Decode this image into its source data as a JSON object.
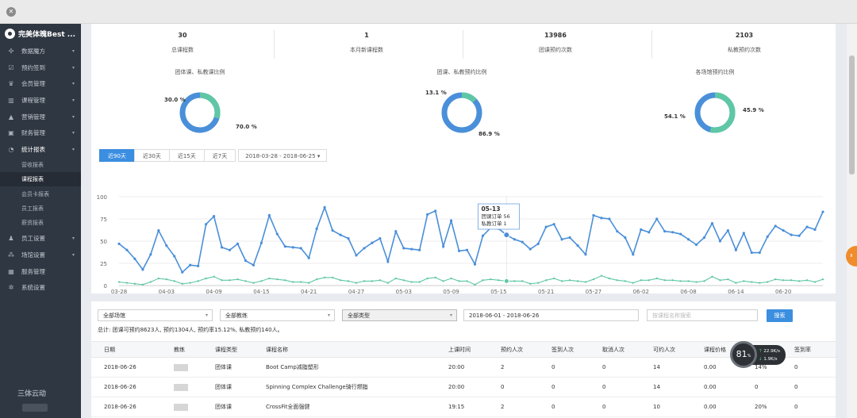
{
  "sidebar": {
    "brand": "完美体魄Best ...",
    "items": [
      {
        "label": "数据魔方",
        "icon": "puzzle-icon"
      },
      {
        "label": "预约签到",
        "icon": "checkbox-icon"
      },
      {
        "label": "会员管理",
        "icon": "crown-icon"
      },
      {
        "label": "课程管理",
        "icon": "book-icon"
      },
      {
        "label": "营销管理",
        "icon": "chart-icon"
      },
      {
        "label": "财务管理",
        "icon": "wallet-icon"
      },
      {
        "label": "统计报表",
        "icon": "pie-icon"
      }
    ],
    "subitems": [
      "营收报表",
      "课程报表",
      "会员卡报表",
      "员工报表",
      "薪资报表"
    ],
    "active_subitem": "课程报表",
    "items_after": [
      {
        "label": "员工设置",
        "icon": "person-icon"
      },
      {
        "label": "场馆设置",
        "icon": "sitemap-icon"
      },
      {
        "label": "服务管理",
        "icon": "grid-icon"
      },
      {
        "label": "系统设置",
        "icon": "gear-icon"
      }
    ],
    "footer_logo": "三体云动"
  },
  "stats": [
    {
      "value": "30",
      "label": "总课程数"
    },
    {
      "value": "1",
      "label": "本月新课程数"
    },
    {
      "value": "13986",
      "label": "团课预约次数"
    },
    {
      "value": "2103",
      "label": "私教预约次数"
    }
  ],
  "donuts": [
    {
      "title": "团体课、私教课比例",
      "a_label": "30.0 %",
      "b_label": "70.0 %",
      "a": 30.0,
      "b": 70.0
    },
    {
      "title": "团课、私教预约比例",
      "a_label": "13.1 %",
      "b_label": "86.9 %",
      "a": 13.1,
      "b": 86.9
    },
    {
      "title": "各场馆预约比例",
      "a_label": "54.1 %",
      "b_label": "45.9 %",
      "a": 54.1,
      "b": 45.9
    }
  ],
  "colors": {
    "blue": "#4a8fd9",
    "teal": "#5fc7a5",
    "accent": "#3b8ee0",
    "sidebar": "#2f3742"
  },
  "range_tabs": [
    "近90天",
    "近30天",
    "近15天",
    "近7天"
  ],
  "active_tab": "近90天",
  "date_range": "2018-03-28 - 2018-06-25",
  "chart_data": {
    "type": "line",
    "x": [
      "03-28",
      "03-29",
      "03-30",
      "03-31",
      "04-01",
      "04-02",
      "04-03",
      "04-04",
      "04-05",
      "04-06",
      "04-07",
      "04-08",
      "04-09",
      "04-10",
      "04-11",
      "04-12",
      "04-13",
      "04-14",
      "04-15",
      "04-16",
      "04-17",
      "04-18",
      "04-19",
      "04-20",
      "04-21",
      "04-22",
      "04-23",
      "04-24",
      "04-25",
      "04-26",
      "04-27",
      "04-28",
      "04-29",
      "04-30",
      "05-01",
      "05-02",
      "05-03",
      "05-04",
      "05-05",
      "05-06",
      "05-07",
      "05-08",
      "05-09",
      "05-10",
      "05-11",
      "05-12",
      "05-13",
      "05-14",
      "05-15",
      "05-16",
      "05-17",
      "05-18",
      "05-19",
      "05-20",
      "05-21",
      "05-22",
      "05-23",
      "05-24",
      "05-25",
      "05-26",
      "05-27",
      "05-28",
      "05-29",
      "05-30",
      "05-31",
      "06-01",
      "06-02",
      "06-03",
      "06-04",
      "06-05",
      "06-06",
      "06-07",
      "06-08",
      "06-09",
      "06-10",
      "06-11",
      "06-12",
      "06-13",
      "06-14",
      "06-15",
      "06-16",
      "06-17",
      "06-18",
      "06-19",
      "06-20",
      "06-21",
      "06-22",
      "06-23",
      "06-24",
      "06-25"
    ],
    "xticks": [
      "03-28",
      "04-03",
      "04-09",
      "04-15",
      "04-21",
      "04-27",
      "05-03",
      "05-09",
      "05-15",
      "05-21",
      "05-27",
      "06-02",
      "06-08",
      "06-14",
      "06-20"
    ],
    "ylim": [
      0,
      100
    ],
    "yticks": [
      0,
      25,
      50,
      75,
      100
    ],
    "series": [
      {
        "name": "团课订单",
        "color": "#4a8fd9",
        "values": [
          47,
          40,
          30,
          18,
          35,
          62,
          45,
          33,
          15,
          23,
          22,
          69,
          78,
          43,
          40,
          47,
          28,
          23,
          48,
          79,
          58,
          44,
          43,
          42,
          31,
          64,
          88,
          62,
          57,
          53,
          34,
          42,
          48,
          53,
          27,
          61,
          42,
          41,
          40,
          80,
          84,
          44,
          73,
          39,
          40,
          24,
          56,
          65,
          64,
          57,
          52,
          49,
          41,
          47,
          66,
          69,
          52,
          54,
          45,
          35,
          79,
          76,
          75,
          61,
          54,
          35,
          63,
          60,
          75,
          61,
          60,
          58,
          52,
          46,
          54,
          70,
          50,
          62,
          40,
          59,
          37,
          37,
          55,
          67,
          62,
          57,
          56,
          66,
          63,
          83
        ]
      },
      {
        "name": "私教订单",
        "color": "#5fc7a5",
        "values": [
          4,
          3,
          2,
          1,
          4,
          8,
          7,
          5,
          2,
          3,
          5,
          8,
          10,
          6,
          6,
          7,
          5,
          3,
          5,
          8,
          7,
          6,
          4,
          4,
          3,
          7,
          9,
          9,
          6,
          5,
          3,
          5,
          5,
          6,
          3,
          8,
          6,
          4,
          4,
          8,
          9,
          5,
          8,
          5,
          5,
          1,
          6,
          7,
          6,
          5,
          5,
          5,
          2,
          3,
          6,
          8,
          5,
          6,
          5,
          4,
          7,
          11,
          8,
          6,
          5,
          3,
          6,
          6,
          8,
          6,
          6,
          5,
          5,
          4,
          5,
          10,
          6,
          7,
          3,
          5,
          4,
          3,
          4,
          7,
          6,
          6,
          5,
          6,
          4,
          7
        ]
      }
    ],
    "tooltip": {
      "date": "05-13",
      "line1": "团课订单  56",
      "line2": "私教订单  1"
    }
  },
  "filters": {
    "venue": "全部场馆",
    "coach": "全部教练",
    "type": "全部类型",
    "date": "2018-06-01 - 2018-06-26",
    "search_placeholder": "按课程名称搜索",
    "search_button": "搜索"
  },
  "summary": "总计: 团课可预约8623人, 预约1304人, 预约率15.12%, 私教预约140人。",
  "table": {
    "columns": [
      "日期",
      "教练",
      "课程类型",
      "课程名称",
      "上课时间",
      "预约人次",
      "签到人次",
      "取消人次",
      "可约人次",
      "课程价格",
      "",
      "签到率"
    ],
    "rows": [
      [
        "2018-06-26",
        "",
        "团体课",
        "Boot Camp减脂塑形",
        "20:00",
        "2",
        "0",
        "0",
        "14",
        "0.00",
        "14%",
        "0"
      ],
      [
        "2018-06-26",
        "",
        "团体课",
        "Spinning Complex Challenge骑行燃脂",
        "20:00",
        "0",
        "0",
        "0",
        "14",
        "0.00",
        "0",
        "0"
      ],
      [
        "2018-06-26",
        "",
        "团体课",
        "CrossFit全面强健",
        "19:15",
        "2",
        "0",
        "0",
        "10",
        "0.00",
        "20%",
        "0"
      ]
    ]
  },
  "speed": {
    "percent": "81",
    "unit": "%",
    "up": "22.9",
    "down": "1.9",
    "rate_unit": "K/s"
  },
  "side_handle": "8"
}
